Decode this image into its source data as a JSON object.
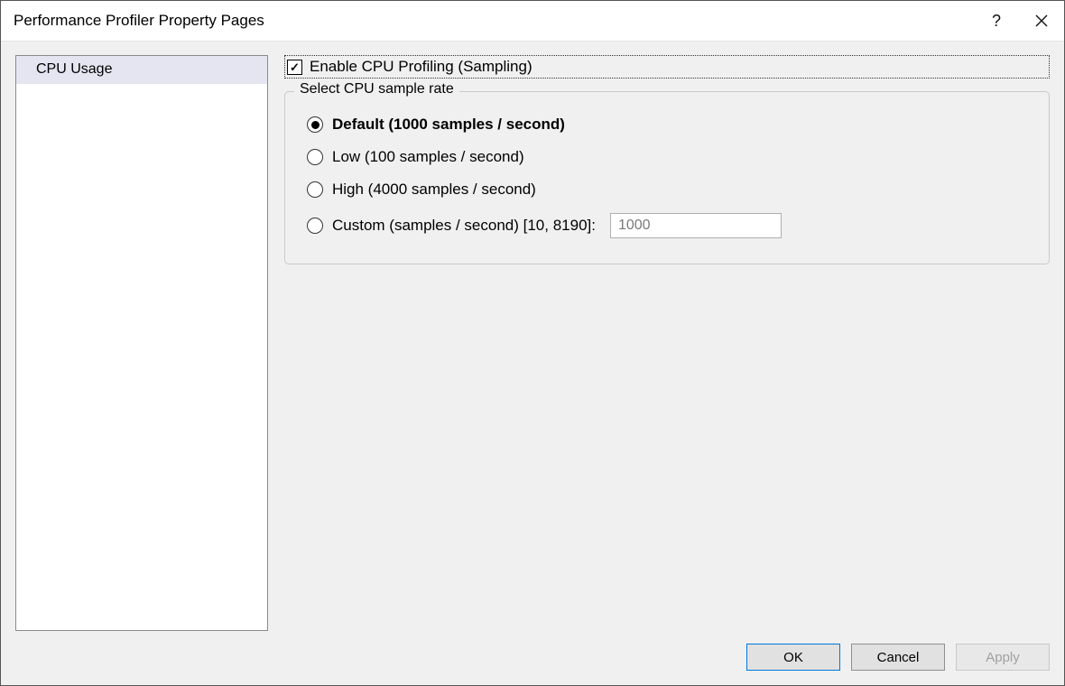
{
  "titlebar": {
    "title": "Performance Profiler Property Pages",
    "help_tooltip": "?",
    "close_tooltip": "Close"
  },
  "sidebar": {
    "items": [
      {
        "label": "CPU Usage",
        "selected": true
      }
    ]
  },
  "content": {
    "enable_checkbox": {
      "label": "Enable CPU Profiling (Sampling)",
      "checked": true
    },
    "sample_rate_group": {
      "legend": "Select CPU sample rate",
      "options": [
        {
          "id": "default",
          "label": "Default (1000 samples / second)",
          "selected": true
        },
        {
          "id": "low",
          "label": "Low (100 samples / second)",
          "selected": false
        },
        {
          "id": "high",
          "label": "High (4000 samples / second)",
          "selected": false
        },
        {
          "id": "custom",
          "label": "Custom (samples / second) [10, 8190]:",
          "selected": false
        }
      ],
      "custom_value": "1000",
      "custom_min": 10,
      "custom_max": 8190
    }
  },
  "buttons": {
    "ok": "OK",
    "cancel": "Cancel",
    "apply": "Apply"
  }
}
